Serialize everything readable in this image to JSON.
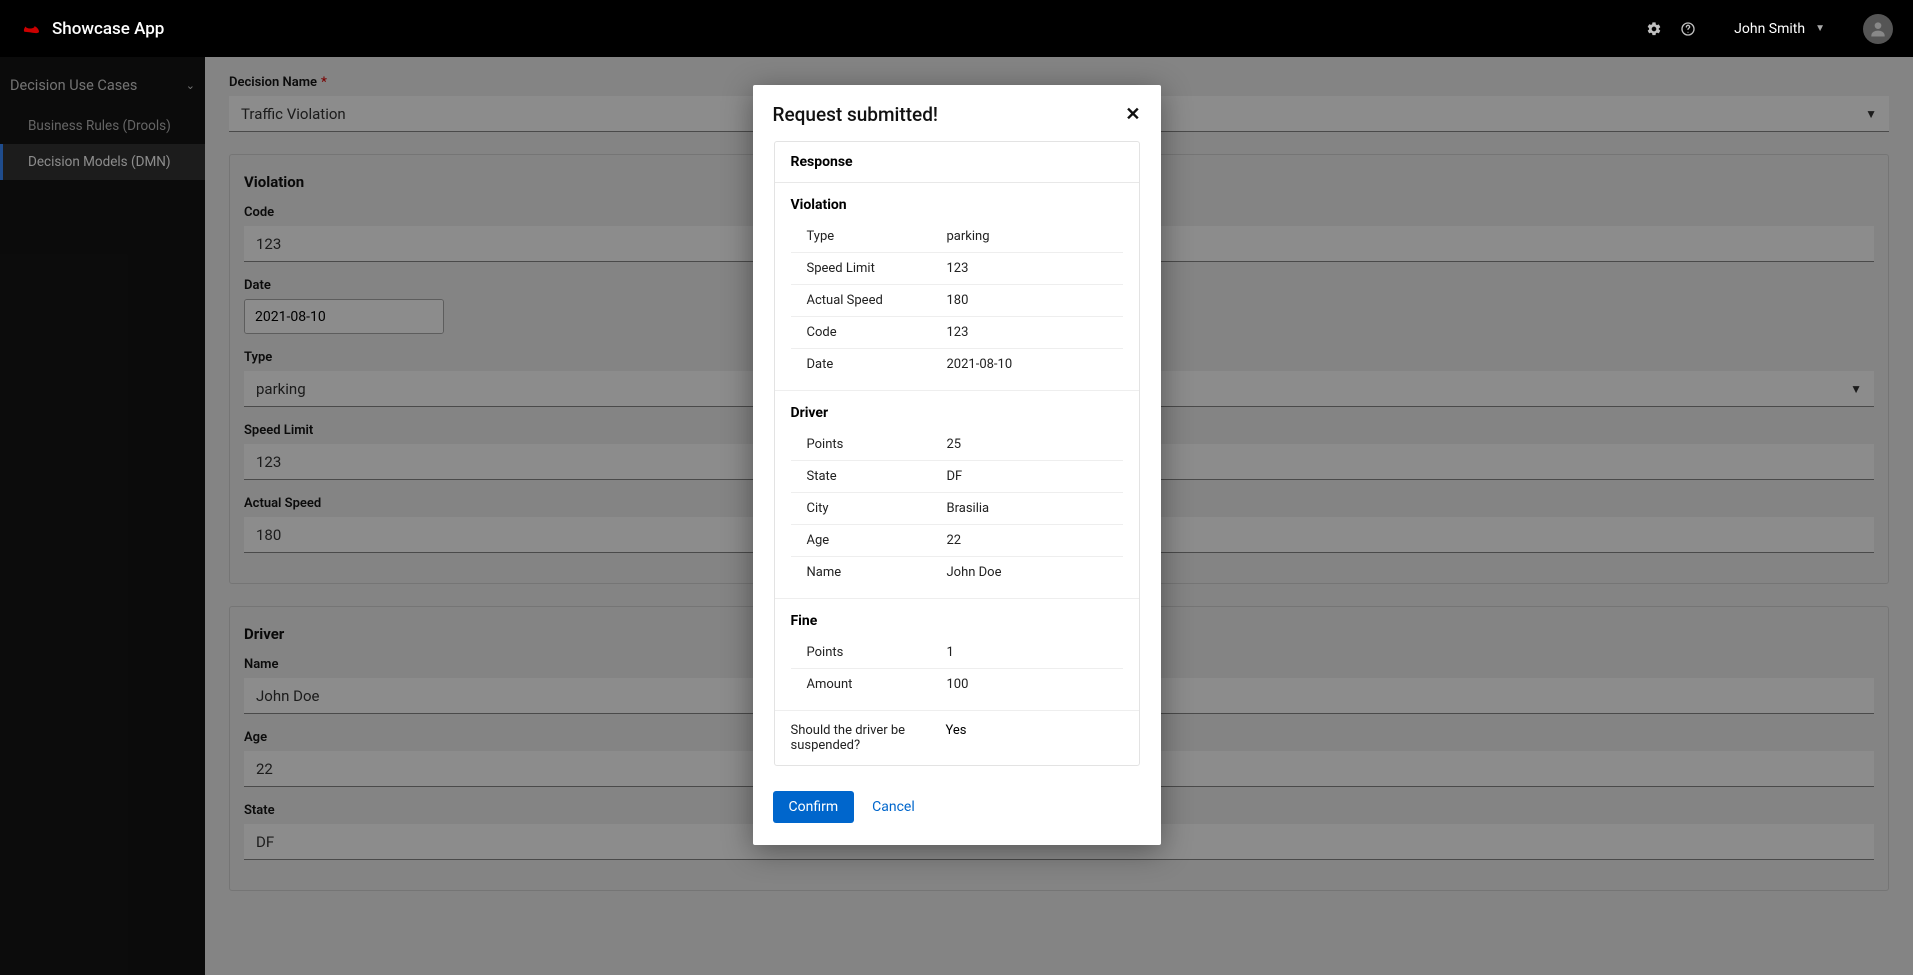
{
  "header": {
    "app_title": "Showcase App",
    "user_name": "John Smith"
  },
  "sidebar": {
    "group_title": "Decision Use Cases",
    "items": [
      {
        "label": "Business Rules (Drools)"
      },
      {
        "label": "Decision Models (DMN)"
      }
    ]
  },
  "form": {
    "decision_name_label": "Decision Name",
    "decision_name_value": "Traffic Violation",
    "violation": {
      "title": "Violation",
      "code_label": "Code",
      "code_value": "123",
      "date_label": "Date",
      "date_value": "2021-08-10",
      "type_label": "Type",
      "type_value": "parking",
      "speed_limit_label": "Speed Limit",
      "speed_limit_value": "123",
      "actual_speed_label": "Actual Speed",
      "actual_speed_value": "180"
    },
    "driver": {
      "title": "Driver",
      "name_label": "Name",
      "name_value": "John Doe",
      "age_label": "Age",
      "age_value": "22",
      "state_label": "State",
      "state_value": "DF"
    }
  },
  "modal": {
    "title": "Request submitted!",
    "response_label": "Response",
    "violation": {
      "title": "Violation",
      "rows": [
        {
          "k": "Type",
          "v": "parking"
        },
        {
          "k": "Speed Limit",
          "v": "123"
        },
        {
          "k": "Actual Speed",
          "v": "180"
        },
        {
          "k": "Code",
          "v": "123"
        },
        {
          "k": "Date",
          "v": "2021-08-10"
        }
      ]
    },
    "driver": {
      "title": "Driver",
      "rows": [
        {
          "k": "Points",
          "v": "25"
        },
        {
          "k": "State",
          "v": "DF"
        },
        {
          "k": "City",
          "v": "Brasilia"
        },
        {
          "k": "Age",
          "v": "22"
        },
        {
          "k": "Name",
          "v": "John Doe"
        }
      ]
    },
    "fine": {
      "title": "Fine",
      "rows": [
        {
          "k": "Points",
          "v": "1"
        },
        {
          "k": "Amount",
          "v": "100"
        }
      ]
    },
    "suspend_question": "Should the driver be suspended?",
    "suspend_answer": "Yes",
    "confirm_label": "Confirm",
    "cancel_label": "Cancel"
  }
}
